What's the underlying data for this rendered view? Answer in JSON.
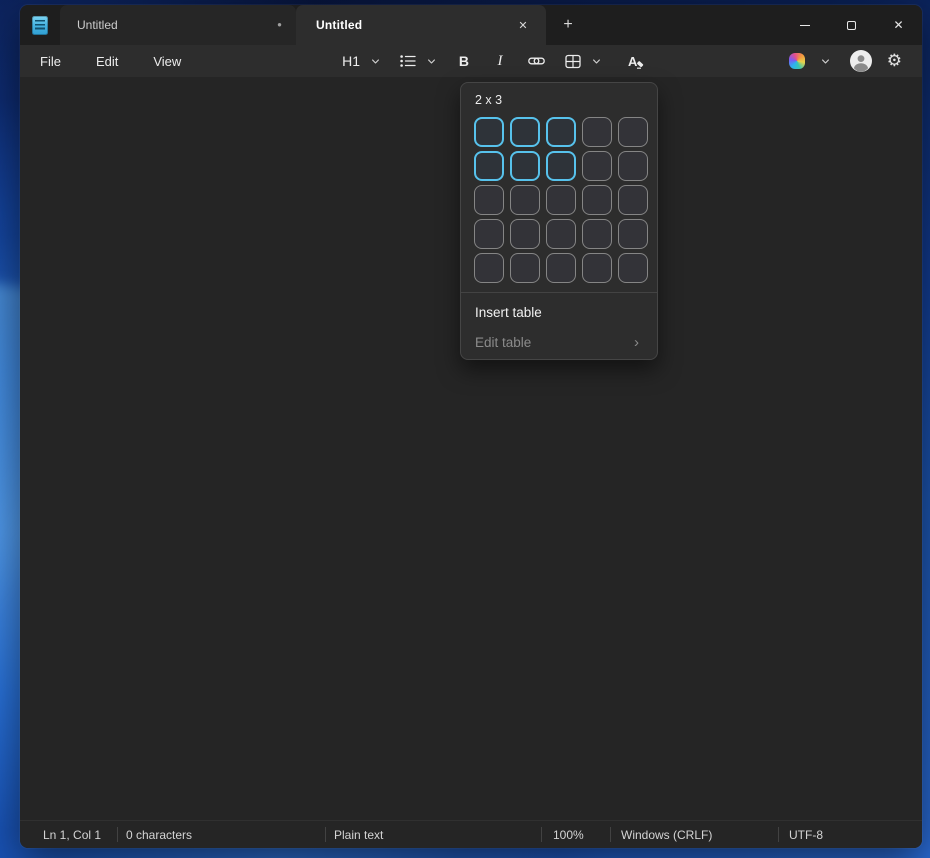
{
  "titlebar": {
    "tabs": [
      {
        "label": "Untitled",
        "state": "modified",
        "modified_indicator": "●"
      },
      {
        "label": "Untitled",
        "state": "active",
        "close_glyph": "✕"
      }
    ],
    "new_tab_glyph": "+",
    "window_controls": {
      "close_glyph": "✕"
    }
  },
  "menubar": {
    "items": [
      {
        "label": "File"
      },
      {
        "label": "Edit"
      },
      {
        "label": "View"
      }
    ]
  },
  "toolbar": {
    "heading_label": "H1",
    "bold_label": "B",
    "italic_label": "I",
    "gear_glyph": "⚙"
  },
  "popup": {
    "size_label": "2 x 3",
    "grid": {
      "rows": 5,
      "cols": 5,
      "selected_rows": 2,
      "selected_cols": 3
    },
    "items": {
      "insert": "Insert table",
      "edit": "Edit table",
      "edit_chevron": "›"
    }
  },
  "statusbar": {
    "line_col": "Ln 1, Col 1",
    "characters": "0 characters",
    "format": "Plain text",
    "zoom": "100%",
    "line_ending": "Windows (CRLF)",
    "encoding": "UTF-8"
  },
  "colors": {
    "accent_blue": "#57c2ec",
    "titlebar_bg": "#1e1e1e",
    "toolbar_bg": "#2d2d2d",
    "editor_bg": "#252525",
    "popup_bg": "#2d2d2d"
  }
}
